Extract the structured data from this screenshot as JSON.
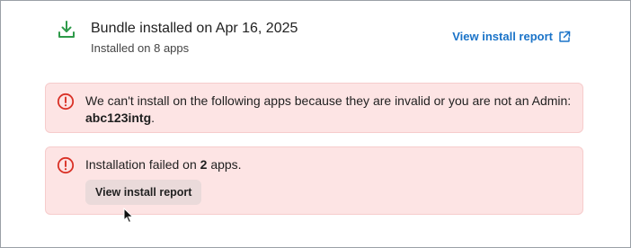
{
  "header": {
    "icon": "download-icon",
    "title": "Bundle installed on Apr 16, 2025",
    "subtitle": "Installed on 8 apps",
    "report_link": "View install report",
    "report_link_icon": "external-link-icon",
    "accent_color": "#1a73c8",
    "success_color": "#2e9a4a"
  },
  "alerts": {
    "invalid": {
      "icon": "warning-circle-icon",
      "text_prefix": "We can't install on the following apps because they are invalid or you are not an Admin: ",
      "app_name": "abc123intg",
      "text_suffix": "."
    },
    "failed": {
      "icon": "warning-circle-icon",
      "text_prefix": "Installation failed on ",
      "count": "2",
      "text_suffix": " apps.",
      "button_label": "View install report"
    },
    "color": "#fde4e4",
    "icon_color": "#d93025"
  }
}
